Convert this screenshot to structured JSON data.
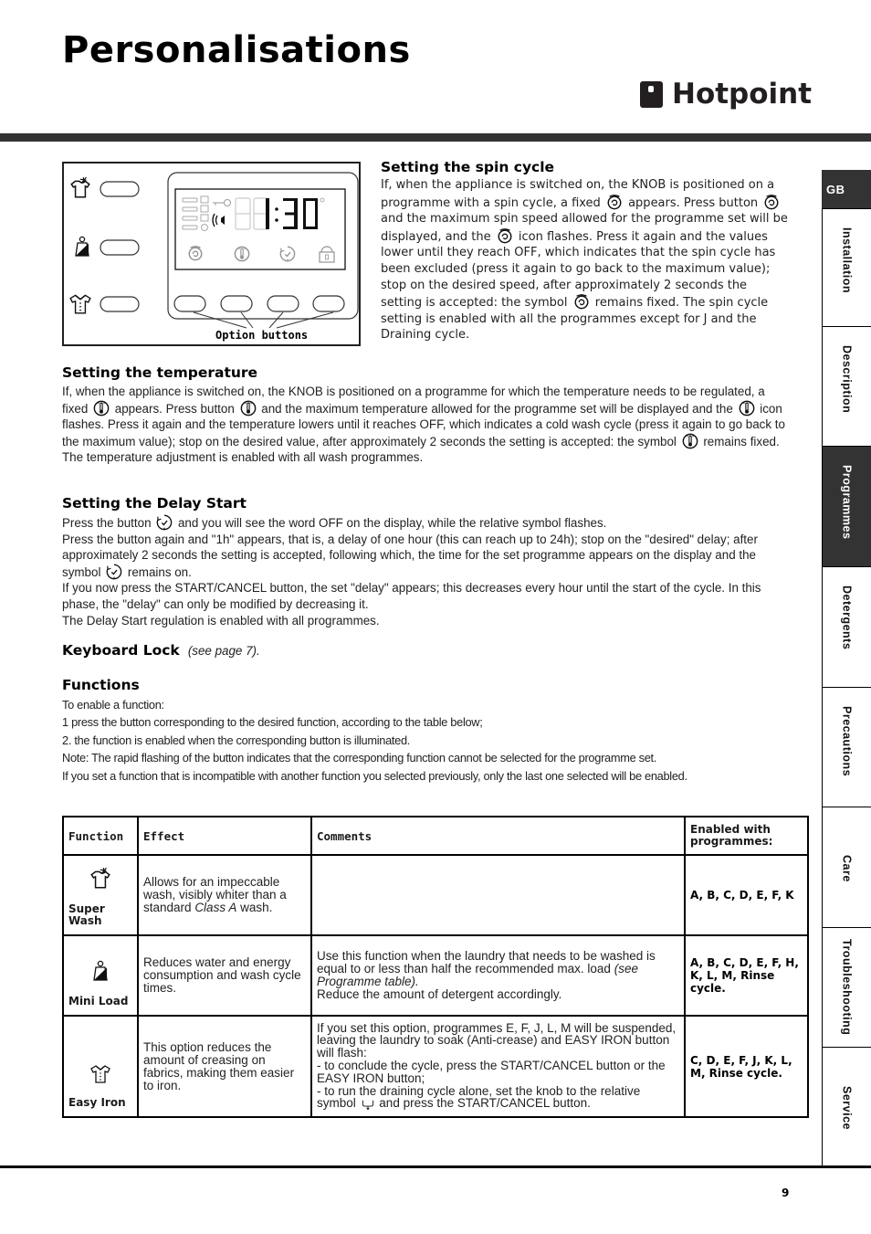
{
  "header": {
    "title": "Personalisations",
    "brand": "Hotpoint"
  },
  "side_nav": {
    "language": "GB",
    "tabs": [
      {
        "label": "Installation",
        "active": false
      },
      {
        "label": "Description",
        "active": false
      },
      {
        "label": "Programmes",
        "active": true
      },
      {
        "label": "Detergents",
        "active": false
      },
      {
        "label": "Precautions",
        "active": false
      },
      {
        "label": "Care",
        "active": false
      },
      {
        "label": "Troubleshooting",
        "active": false
      },
      {
        "label": "Service",
        "active": false
      }
    ]
  },
  "panel_figure": {
    "display_time": "1:30",
    "caption": "Option buttons",
    "left_buttons": [
      "super-wash",
      "mini-load",
      "easy-iron"
    ],
    "option_buttons": [
      "spin",
      "temperature",
      "delay-start",
      "keyboard-lock"
    ]
  },
  "icons": {
    "spin": "spin-icon",
    "temperature": "thermometer-icon",
    "delay": "delay-clock-icon",
    "lock": "padlock-icon",
    "super_wash": "super-wash-shirt-icon",
    "mini_load": "mini-load-weight-icon",
    "easy_iron": "easy-iron-shirt-icon",
    "drain": "drain-icon"
  },
  "spin": {
    "heading": "Setting the spin cycle",
    "p1": "If, when the appliance is switched on, the KNOB is positioned on a programme with a spin cycle, a fixed",
    "p2": "appears. Press button",
    "p3": "and the maximum spin speed allowed for the programme set will be displayed, and the",
    "p4": "icon flashes. Press it again and the values lower until they reach OFF, which indicates that the spin cycle has been excluded (press it again to go back to the maximum value); stop on the desired speed, after approximately 2 seconds the setting is accepted: the symbol",
    "p5": "remains fixed. The spin cycle setting is enabled with all the programmes except for J and the Draining cycle."
  },
  "temperature": {
    "heading": "Setting the temperature",
    "p1": "If, when the appliance is switched on, the KNOB is positioned on a programme for which the temperature needs to be regulated, a fixed",
    "p2": "appears. Press button",
    "p3": "and the maximum temperature allowed for the programme set will be displayed and the",
    "p4": "icon flashes. Press it again and the temperature lowers until it reaches OFF, which indicates a cold wash cycle (press it again to go back to the maximum value); stop on the desired value, after approximately 2 seconds the setting is accepted: the symbol",
    "p5": "remains fixed.",
    "p6": "The temperature adjustment is enabled with all wash programmes."
  },
  "delay": {
    "heading": "Setting the Delay Start",
    "l1a": "Press the button",
    "l1b": "and you will see the word OFF on the display, while the relative symbol flashes.",
    "l2a": "Press the button again and \"1h\" appears, that is, a delay of one hour (this can reach up to 24h); stop on the \"desired\" delay; after approximately 2 seconds the setting is accepted, following which, the time for the set programme appears on the display and the symbol",
    "l2b": "remains on.",
    "l3": "If you now press the START/CANCEL button, the set \"delay\" appears; this decreases every hour until the start of the cycle. In this phase, the \"delay\" can only be modified by decreasing it.",
    "l4": "The Delay Start regulation is enabled with all programmes."
  },
  "keyboard_lock": {
    "heading": "Keyboard Lock",
    "ref": "(see page 7)."
  },
  "functions": {
    "heading": "Functions",
    "lines": [
      "To enable a function:",
      "1 press the button corresponding to the desired function, according to the table below;",
      "2. the function is enabled when the corresponding button is illuminated.",
      "Note: The rapid flashing of the button indicates that the corresponding function cannot be selected for the programme set.",
      "If you set a function that is incompatible with another function you selected previously, only the last one selected will be enabled."
    ]
  },
  "table": {
    "headers": [
      "Function",
      "Effect",
      "Comments",
      "Enabled with programmes:"
    ],
    "rows": [
      {
        "function": "Super Wash",
        "effect_a": "Allows for an impeccable wash, visibly whiter than a standard",
        "effect_italic": "Class A",
        "effect_b": "wash.",
        "comments_a": "",
        "comments_italic": "",
        "comments_b": "",
        "enabled": "A, B, C, D, E, F, K"
      },
      {
        "function": "Mini Load",
        "effect_a": "Reduces water and energy consumption and wash cycle times.",
        "comments_a": "Use this function when the laundry that needs to be washed is equal to or less than half the recommended max. load",
        "comments_italic": "(see Programme table).",
        "comments_b": "Reduce the amount of detergent accordingly.",
        "enabled": "A, B, C, D, E, F, H, K, L, M, Rinse cycle."
      },
      {
        "function": "Easy Iron",
        "effect_a": "This option reduces the amount of creasing on fabrics, making them easier to iron.",
        "comments_lines": [
          "If you set this option, programmes E, F, J, L, M will be suspended, leaving the laundry to soak (Anti-crease) and EASY IRON button will flash:",
          "- to conclude the cycle, press the START/CANCEL button or the EASY IRON button;"
        ],
        "comments_last_a": "- to run the draining cycle alone, set the knob to the relative symbol",
        "comments_last_b": "and press the START/CANCEL button.",
        "enabled": "C, D, E, F, J, K, L, M, Rinse cycle."
      }
    ]
  },
  "footer": {
    "page_number": "9"
  }
}
